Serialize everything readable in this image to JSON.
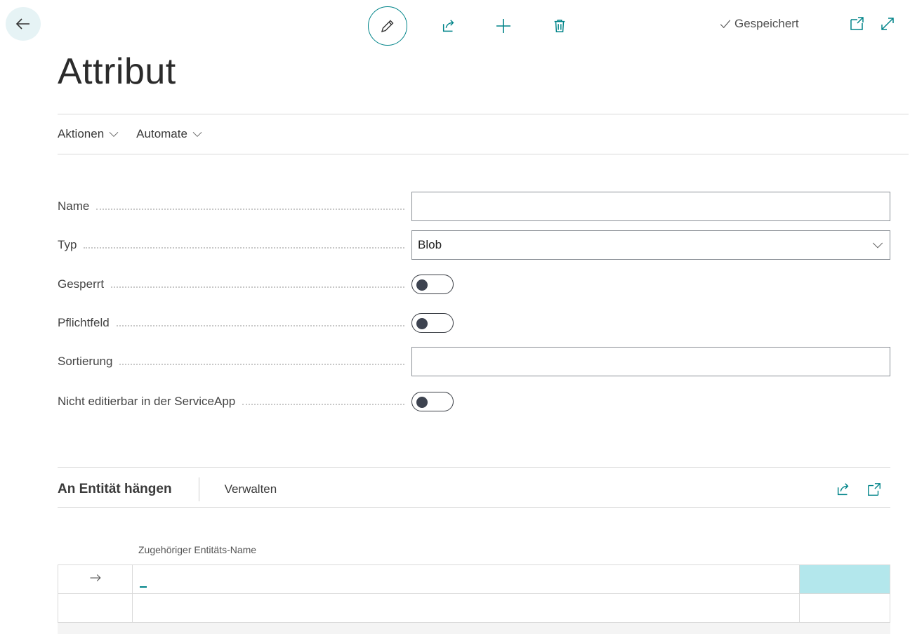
{
  "header": {
    "saved_label": "Gespeichert"
  },
  "page": {
    "title": "Attribut"
  },
  "menu": {
    "items": [
      {
        "label": "Aktionen"
      },
      {
        "label": "Automate"
      }
    ]
  },
  "fields": {
    "name": {
      "label": "Name",
      "value": ""
    },
    "typ": {
      "label": "Typ",
      "value": "Blob"
    },
    "gesperrt": {
      "label": "Gesperrt",
      "checked": false
    },
    "pflichtfeld": {
      "label": "Pflichtfeld",
      "checked": false
    },
    "sortierung": {
      "label": "Sortierung",
      "value": ""
    },
    "nicht_editierbar": {
      "label": "Nicht editierbar in der ServiceApp",
      "checked": false
    }
  },
  "subpage": {
    "title": "An Entität hängen",
    "action": "Verwalten",
    "column_header": "Zugehöriger Entitäts-Name",
    "rows": [
      {
        "value": ""
      },
      {
        "value": ""
      }
    ]
  },
  "colors": {
    "accent": "#008489",
    "selected_cell": "#b3e7ec"
  }
}
